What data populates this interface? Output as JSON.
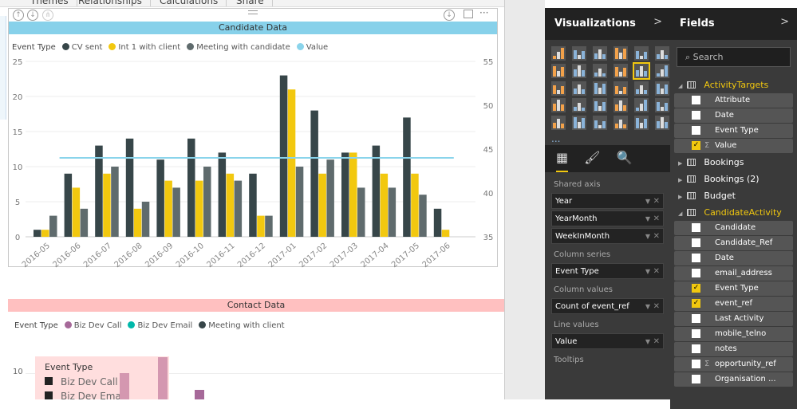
{
  "ribbon": {
    "tabs": [
      "Themes",
      "Relationships",
      "Calculations",
      "Share"
    ]
  },
  "chart1": {
    "title": "Candidate Data",
    "legend_title": "Event Type",
    "more": "···"
  },
  "chart2": {
    "title": "Contact Data",
    "legend_title": "Event Type",
    "legend": [
      {
        "name": "Biz Dev Call",
        "color": "#a66999"
      },
      {
        "name": "Biz Dev Email",
        "color": "#01b8aa"
      },
      {
        "name": "Meeting with client",
        "color": "#374649"
      }
    ],
    "y_tick": "10",
    "tooltip": {
      "title": "Event Type",
      "items": [
        "Biz Dev Call",
        "Biz Dev Email"
      ]
    }
  },
  "chart_data": [
    {
      "type": "bar+line",
      "title": "Candidate Data",
      "categories": [
        "2016-05",
        "2016-06",
        "2016-07",
        "2016-08",
        "2016-09",
        "2016-10",
        "2016-11",
        "2016-12",
        "2017-01",
        "2017-02",
        "2017-03",
        "2017-04",
        "2017-05",
        "2017-06"
      ],
      "series": [
        {
          "name": "CV sent",
          "color": "#374649",
          "values": [
            1,
            9,
            13,
            14,
            11,
            14,
            12,
            9,
            23,
            18,
            12,
            13,
            17,
            4
          ]
        },
        {
          "name": "Int 1 with client",
          "color": "#f2c80f",
          "values": [
            1,
            7,
            9,
            4,
            8,
            8,
            9,
            3,
            21,
            9,
            12,
            9,
            9,
            1
          ]
        },
        {
          "name": "Meeting with candidate",
          "color": "#5f6b6d",
          "values": [
            3,
            4,
            10,
            5,
            7,
            10,
            8,
            3,
            10,
            11,
            7,
            7,
            6,
            null
          ]
        },
        {
          "name": "Value",
          "color": "#8ad4eb",
          "type": "line",
          "axis": "right",
          "values": [
            null,
            44,
            44,
            44,
            44,
            44,
            44,
            44,
            44,
            44,
            44,
            44,
            44,
            44
          ]
        }
      ],
      "y_left": {
        "ticks": [
          0,
          5,
          10,
          15,
          20,
          25
        ],
        "range": [
          0,
          25
        ]
      },
      "y_right": {
        "ticks": [
          35,
          40,
          45,
          50,
          55
        ],
        "range": [
          35,
          55
        ]
      },
      "grid": true,
      "legend_position": "top-left"
    }
  ],
  "visualizations": {
    "title": "Visualizations",
    "chevron": ">",
    "more": "...",
    "wells": [
      {
        "label": "Shared axis",
        "items": [
          "Year",
          "YearMonth",
          "WeekInMonth"
        ]
      },
      {
        "label": "Column series",
        "items": [
          "Event Type"
        ]
      },
      {
        "label": "Column values",
        "items": [
          "Count of event_ref"
        ]
      },
      {
        "label": "Line values",
        "items": [
          "Value"
        ]
      },
      {
        "label": "Tooltips",
        "items": []
      }
    ]
  },
  "fields": {
    "title": "Fields",
    "chevron": ">",
    "search_placeholder": "Search",
    "tables": [
      {
        "name": "ActivityTargets",
        "open": true,
        "fields": [
          {
            "name": "Attribute",
            "checked": false
          },
          {
            "name": "Date",
            "checked": false
          },
          {
            "name": "Event Type",
            "checked": false
          },
          {
            "name": "Value",
            "checked": true,
            "sigma": true
          }
        ]
      },
      {
        "name": "Bookings",
        "open": false
      },
      {
        "name": "Bookings (2)",
        "open": false
      },
      {
        "name": "Budget",
        "open": false
      },
      {
        "name": "CandidateActivity",
        "open": true,
        "fields": [
          {
            "name": "Candidate",
            "checked": false
          },
          {
            "name": "Candidate_Ref",
            "checked": false
          },
          {
            "name": "Date",
            "checked": false
          },
          {
            "name": "email_address",
            "checked": false
          },
          {
            "name": "Event Type",
            "checked": true
          },
          {
            "name": "event_ref",
            "checked": true
          },
          {
            "name": "Last Activity",
            "checked": false
          },
          {
            "name": "mobile_telno",
            "checked": false
          },
          {
            "name": "notes",
            "checked": false
          },
          {
            "name": "opportunity_ref",
            "checked": false,
            "sigma": true
          },
          {
            "name": "Organisation ...",
            "checked": false
          }
        ]
      }
    ]
  }
}
